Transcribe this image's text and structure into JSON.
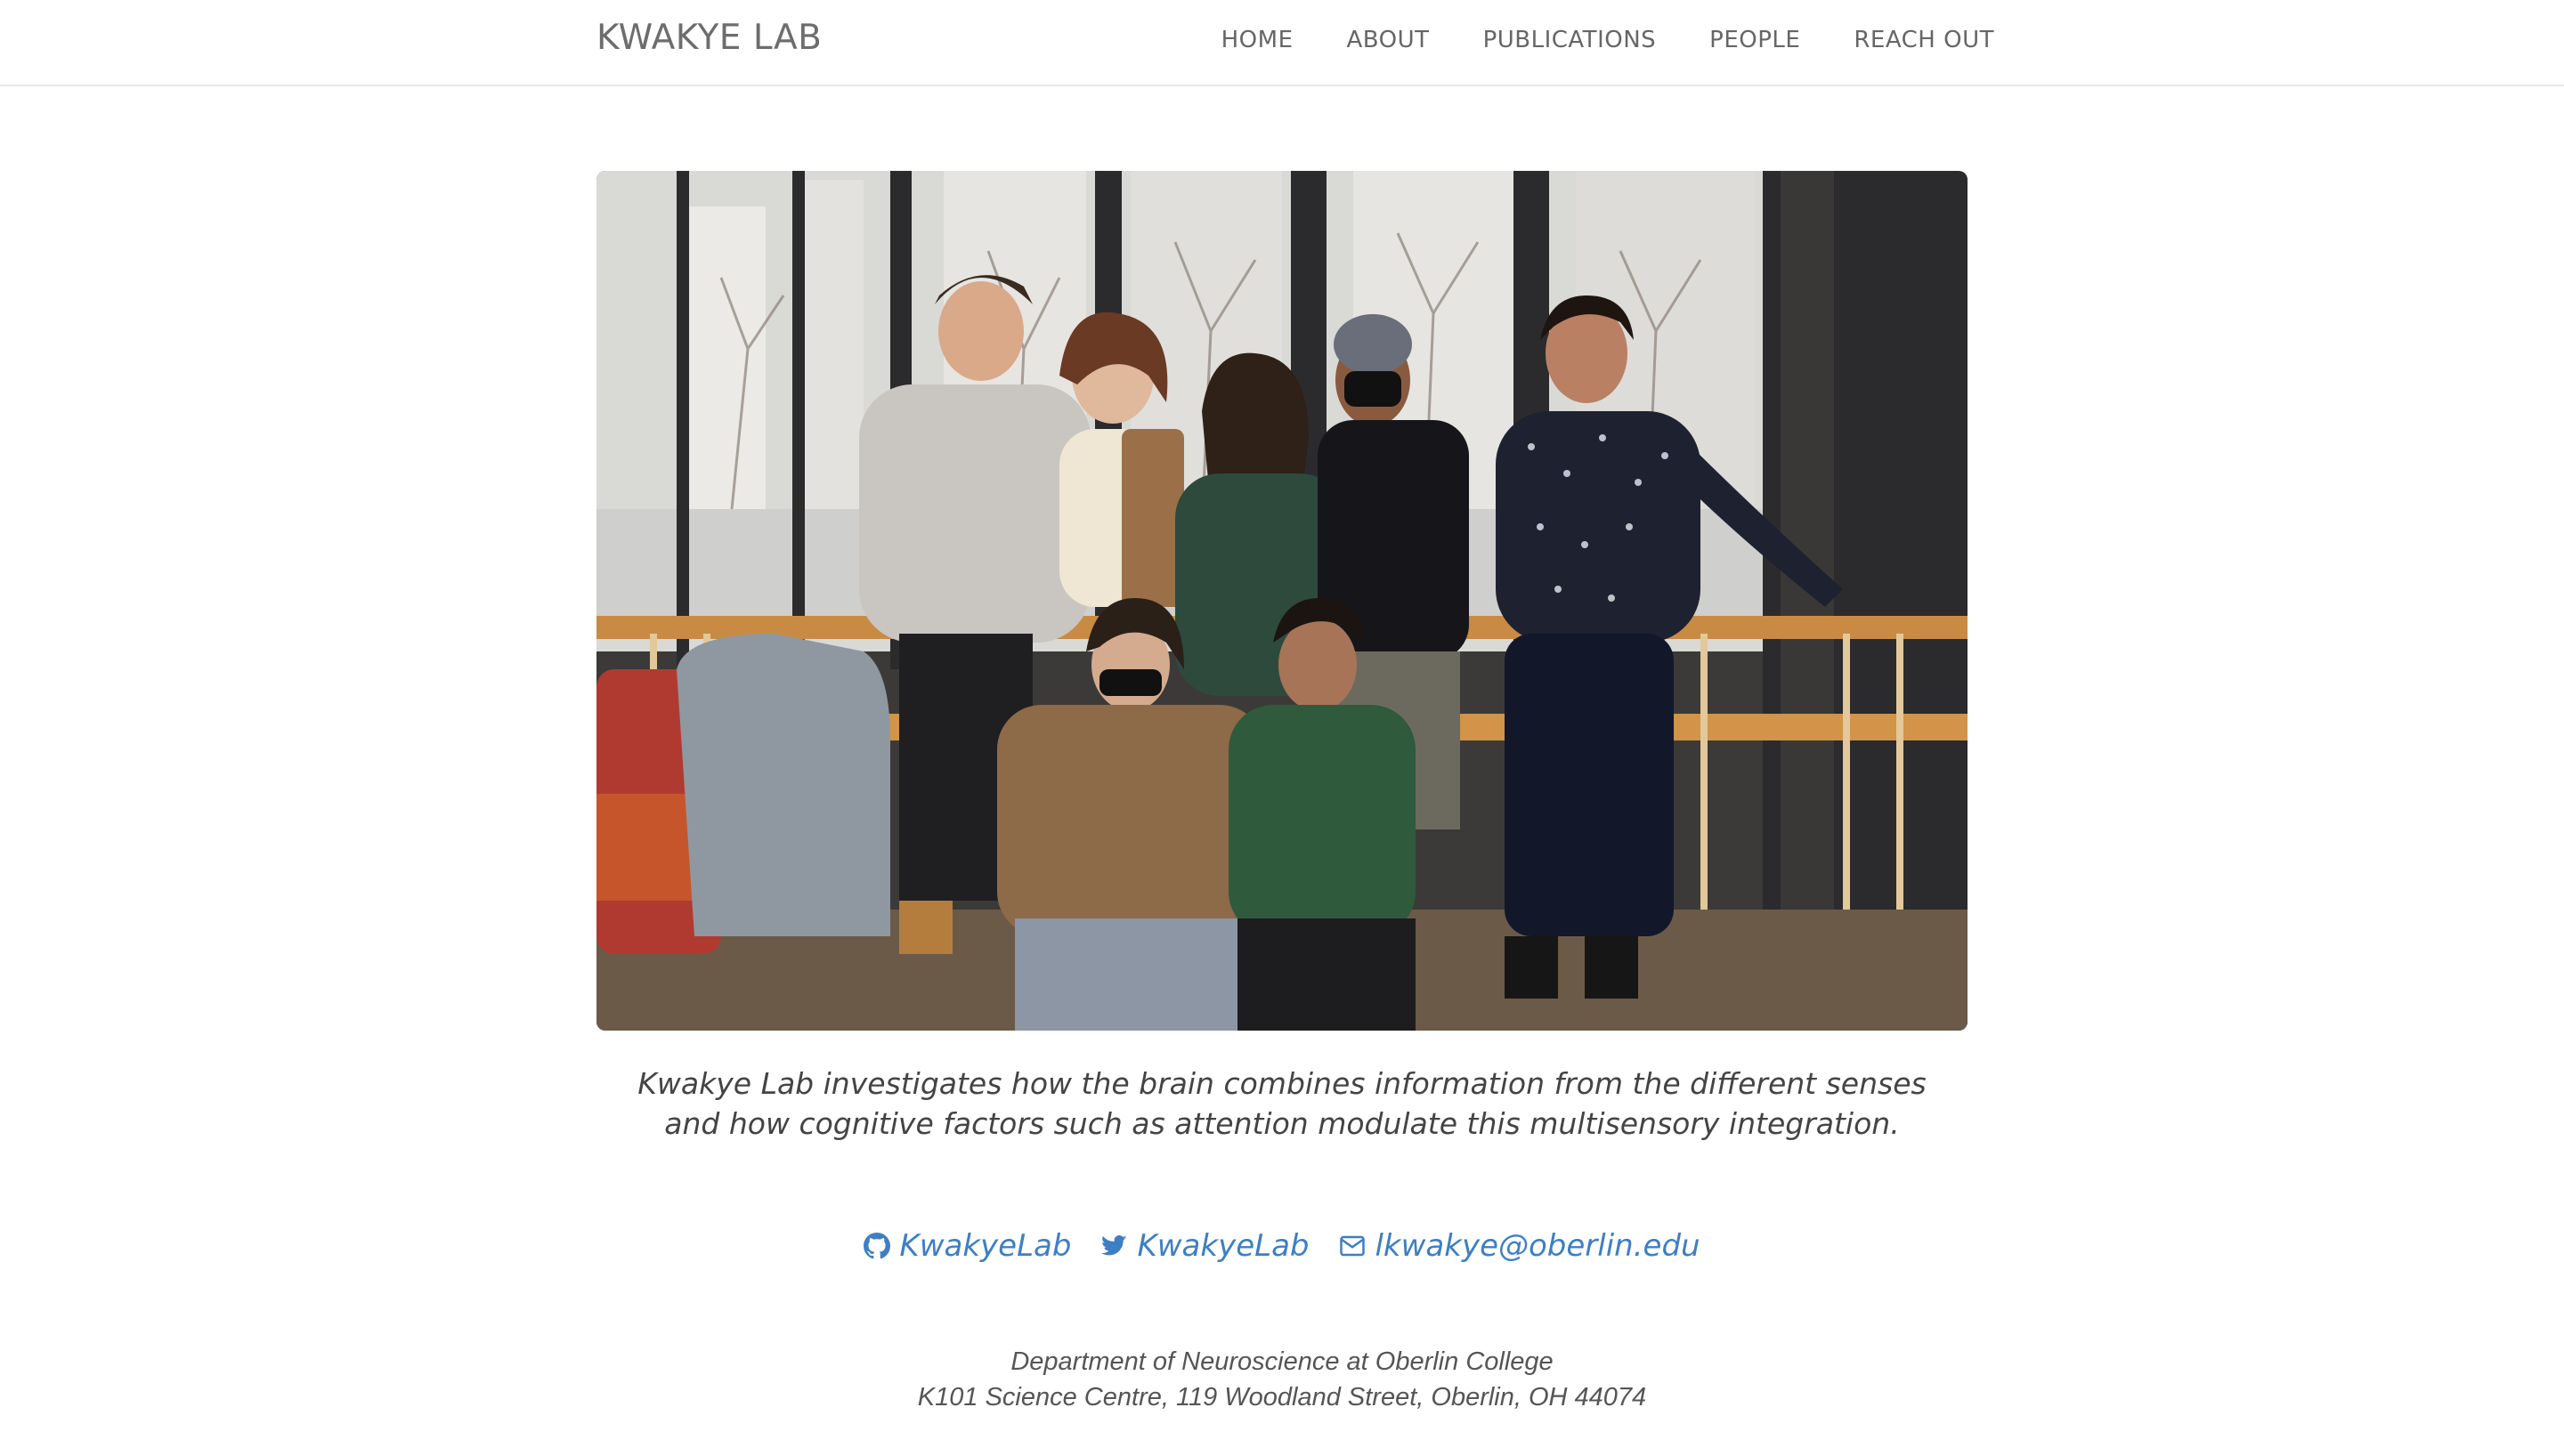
{
  "header": {
    "brand": "KWAKYE LAB",
    "nav": [
      {
        "label": "HOME"
      },
      {
        "label": "ABOUT"
      },
      {
        "label": "PUBLICATIONS"
      },
      {
        "label": "PEOPLE"
      },
      {
        "label": "REACH OUT"
      }
    ]
  },
  "hero": {
    "image_icon": "group-photo"
  },
  "tagline": {
    "line1": "Kwakye Lab investigates how the brain combines information from the different senses",
    "line2": "and how cognitive factors such as attention modulate this multisensory integration."
  },
  "social": {
    "github": {
      "icon": "github-icon",
      "label": "KwakyeLab"
    },
    "twitter": {
      "icon": "twitter-icon",
      "label": "KwakyeLab"
    },
    "email": {
      "icon": "envelope-icon",
      "label": "lkwakye@oberlin.edu"
    }
  },
  "footer": {
    "line1": "Department of Neuroscience at Oberlin College",
    "line2": "K101 Science Centre, 119 Woodland Street, Oberlin, OH 44074"
  },
  "colors": {
    "link": "#3d7fc4",
    "nav_text": "#666666",
    "brand": "#6d6d6d"
  }
}
